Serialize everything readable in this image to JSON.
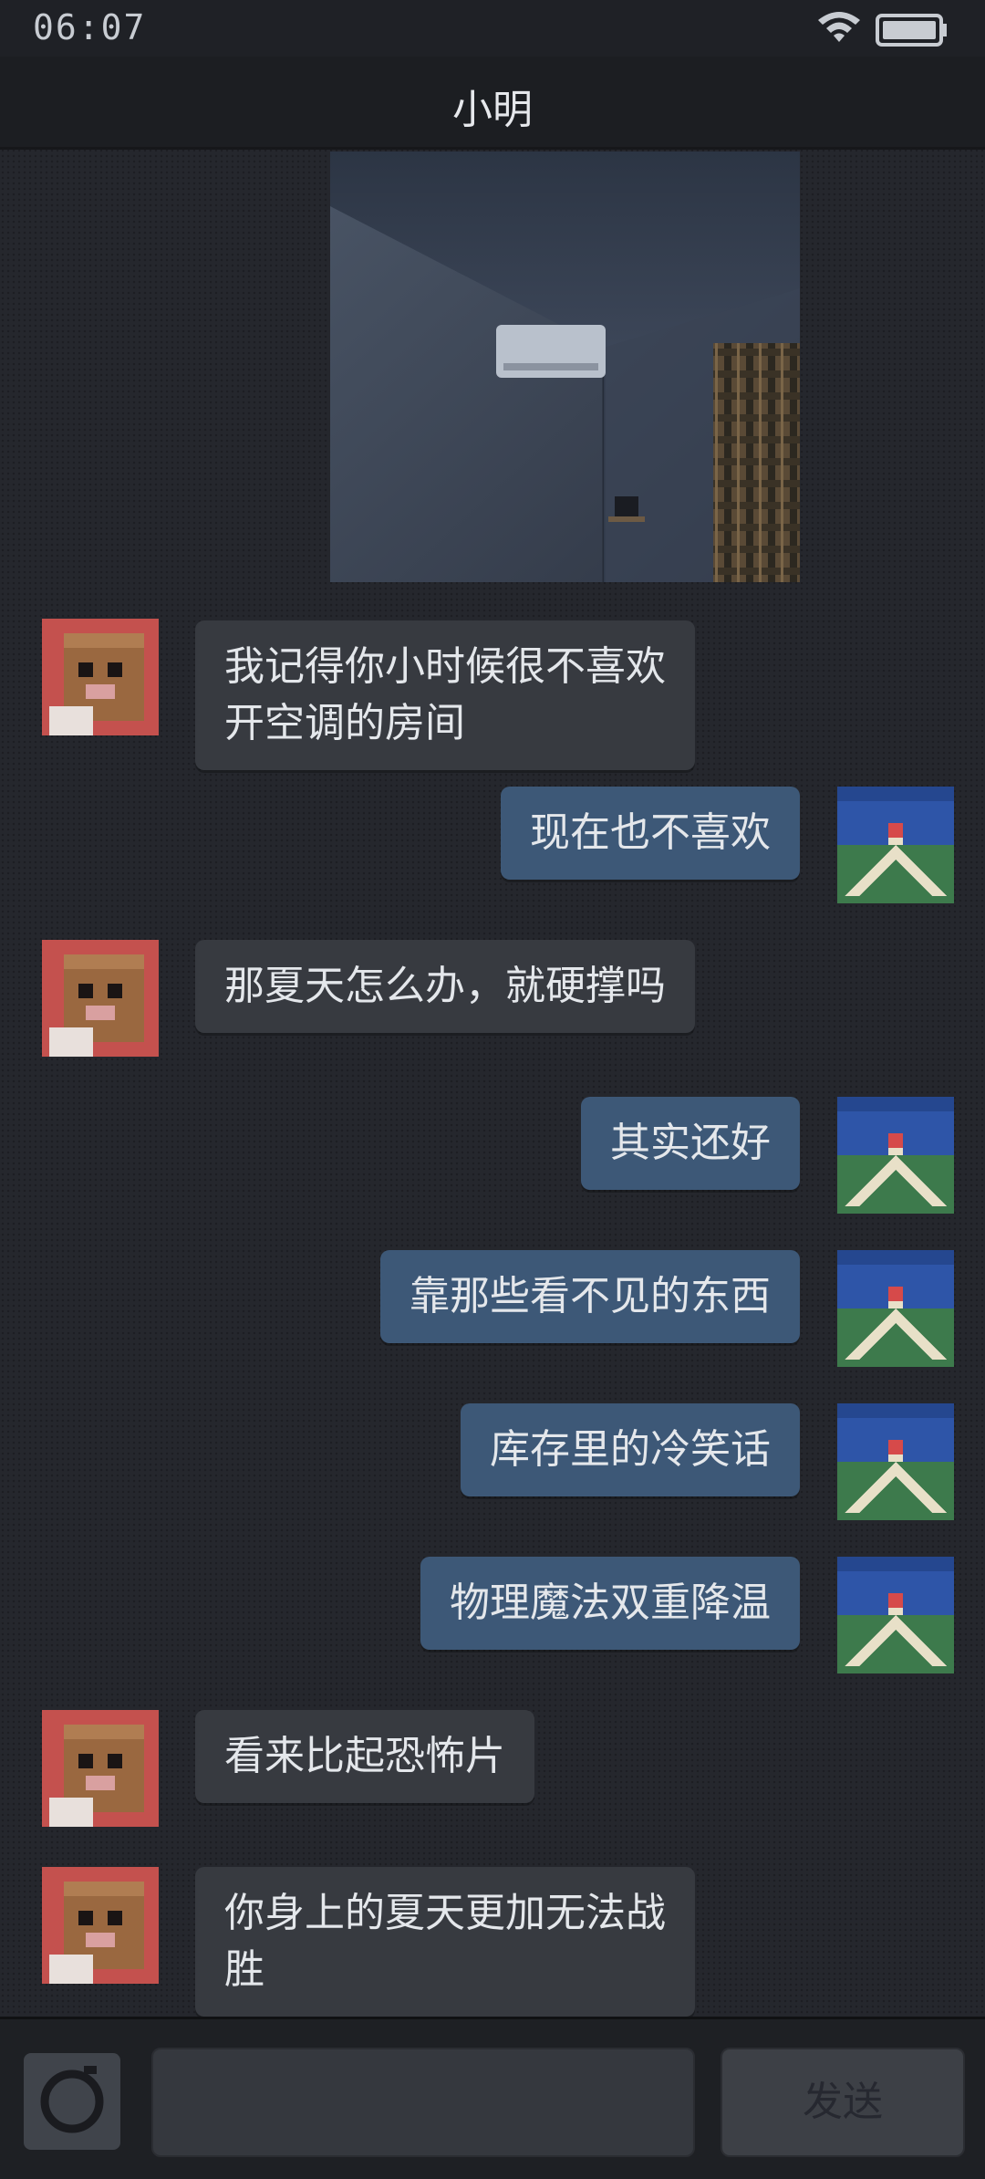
{
  "status_bar": {
    "time": "06:07",
    "wifi_icon": "wifi-icon",
    "battery_icon": "battery-icon"
  },
  "header": {
    "title": "小明"
  },
  "messages": [
    {
      "from": "contact",
      "text_lines": [
        "我记得你小时候很不喜欢",
        "开空调的房间"
      ]
    },
    {
      "from": "me",
      "text_lines": [
        "现在也不喜欢"
      ]
    },
    {
      "from": "contact",
      "text_lines": [
        "那夏天怎么办，就硬撑吗"
      ]
    },
    {
      "from": "me",
      "text_lines": [
        "其实还好"
      ]
    },
    {
      "from": "me",
      "text_lines": [
        "靠那些看不见的东西"
      ]
    },
    {
      "from": "me",
      "text_lines": [
        "库存里的冷笑话"
      ]
    },
    {
      "from": "me",
      "text_lines": [
        "物理魔法双重降温"
      ]
    },
    {
      "from": "contact",
      "text_lines": [
        "看来比起恐怖片"
      ]
    },
    {
      "from": "contact",
      "text_lines": [
        "你身上的夏天更加无法战",
        "胜"
      ]
    }
  ],
  "input_bar": {
    "camera_icon": "camera-icon",
    "message_value": "",
    "send_label": "发送"
  },
  "colors": {
    "background": "#25272d",
    "incoming_bubble": "#373a40",
    "outgoing_bubble": "#3d5877",
    "contact_avatar_bg": "#c4514e",
    "my_avatar_sky": "#2e55a8"
  }
}
